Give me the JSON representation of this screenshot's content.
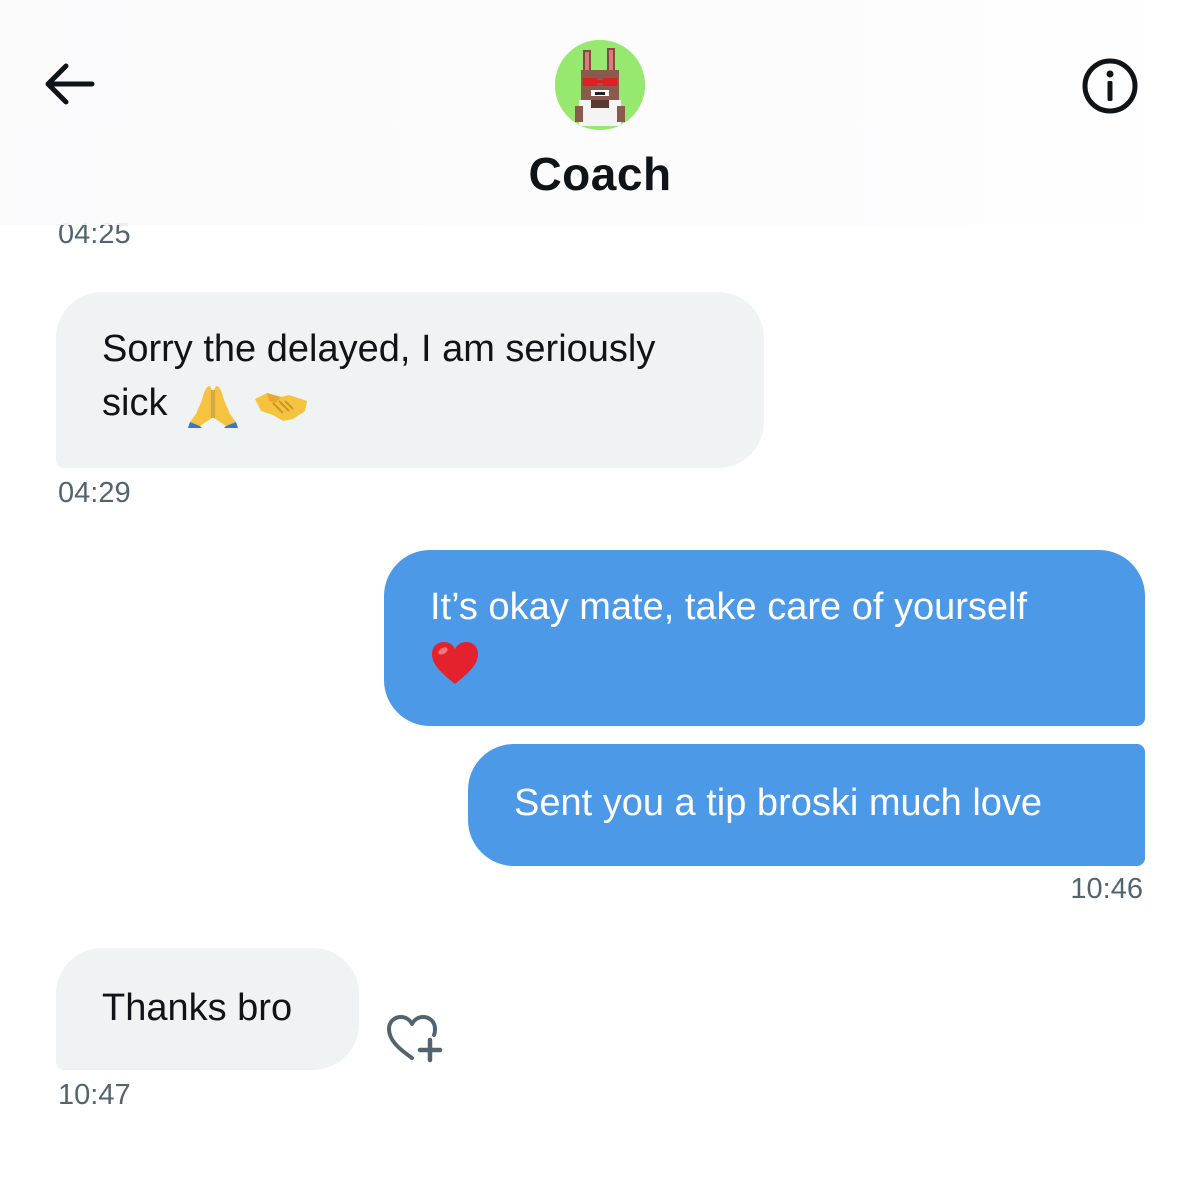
{
  "header": {
    "contact_name": "Coach",
    "back_icon": "arrow-left-icon",
    "info_icon": "info-circle-icon",
    "avatar_bg": "#97e86f"
  },
  "messages": [
    {
      "direction": "incoming",
      "timestamp": "04:25"
    },
    {
      "direction": "incoming",
      "text": "Sorry the delayed, I am seriously",
      "text_line2": "sick",
      "emojis": [
        "folded-hands-emoji",
        "handshake-emoji"
      ],
      "timestamp": "04:29"
    },
    {
      "direction": "outgoing",
      "text": "It’s okay mate, take care of yourself",
      "emojis": [
        "red-heart-emoji"
      ]
    },
    {
      "direction": "outgoing",
      "text": "Sent you a tip broski much love",
      "timestamp": "10:46"
    },
    {
      "direction": "incoming",
      "text": "Thanks bro",
      "timestamp": "10:47",
      "reaction_icon": "heart-plus-icon"
    }
  ],
  "colors": {
    "outgoing_bubble": "#4c99e8",
    "incoming_bubble": "#eff3f4",
    "timestamp_text": "#536471"
  }
}
